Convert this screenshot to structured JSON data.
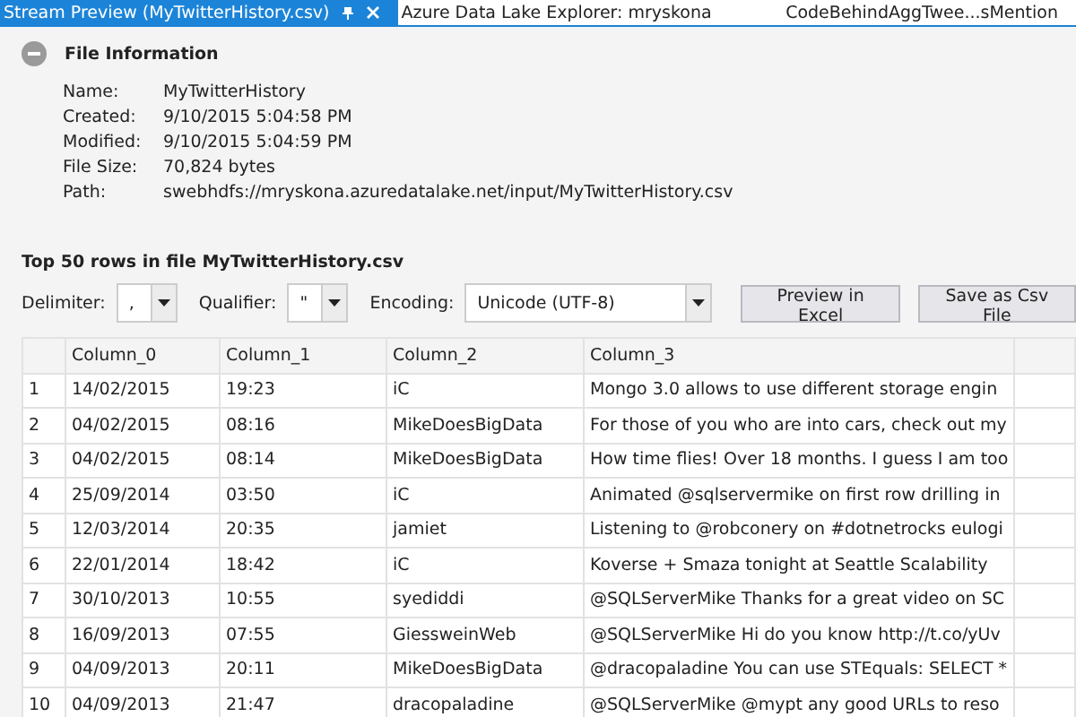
{
  "tabs": [
    {
      "label": "Stream Preview (MyTwitterHistory.csv)",
      "selected": true
    },
    {
      "label": "Azure Data Lake Explorer: mryskona",
      "selected": false
    },
    {
      "label": "CodeBehindAggTwee...sMention",
      "selected": false
    }
  ],
  "file_info": {
    "title": "File Information",
    "expanded": true,
    "fields": [
      {
        "label": "Name:",
        "value": "MyTwitterHistory"
      },
      {
        "label": "Created:",
        "value": "9/10/2015 5:04:58 PM"
      },
      {
        "label": "Modified:",
        "value": "9/10/2015 5:04:59 PM"
      },
      {
        "label": "File Size:",
        "value": "70,824 bytes"
      },
      {
        "label": "Path:",
        "value": "swebhdfs://mryskona.azuredatalake.net/input/MyTwitterHistory.csv"
      }
    ]
  },
  "preview": {
    "title": "Top 50 rows in file MyTwitterHistory.csv",
    "options": [
      {
        "label": "Delimiter:",
        "value": ",",
        "kind": "small"
      },
      {
        "label": "Qualifier:",
        "value": "\"",
        "kind": "small"
      },
      {
        "label": "Encoding:",
        "value": "Unicode (UTF-8)",
        "kind": "wide"
      }
    ],
    "buttons": [
      "Preview in Excel",
      "Save as Csv File"
    ]
  },
  "table": {
    "columns": [
      "Column_0",
      "Column_1",
      "Column_2",
      "Column_3"
    ],
    "rows": [
      {
        "n": "1",
        "cells": [
          "14/02/2015",
          "19:23",
          "iC",
          "Mongo 3.0 allows to use different storage engin"
        ]
      },
      {
        "n": "2",
        "cells": [
          "04/02/2015",
          "08:16",
          "MikeDoesBigData",
          "For those of you who are into cars, check out my"
        ]
      },
      {
        "n": "3",
        "cells": [
          "04/02/2015",
          "08:14",
          "MikeDoesBigData",
          "How time flies! Over 18 months. I guess I am too"
        ]
      },
      {
        "n": "4",
        "cells": [
          "25/09/2014",
          "03:50",
          "iC",
          "Animated @sqlservermike on first row drilling in"
        ]
      },
      {
        "n": "5",
        "cells": [
          "12/03/2014",
          "20:35",
          "jamiet",
          "Listening to @robconery on #dotnetrocks eulogi"
        ]
      },
      {
        "n": "6",
        "cells": [
          "22/01/2014",
          "18:42",
          "iC",
          "Koverse + Smaza tonight at Seattle Scalability"
        ]
      },
      {
        "n": "7",
        "cells": [
          "30/10/2013",
          "10:55",
          "syediddi",
          "@SQLServerMike Thanks for a great video on SC"
        ]
      },
      {
        "n": "8",
        "cells": [
          "16/09/2013",
          "07:55",
          "GiessweinWeb",
          "@SQLServerMike Hi do you know http://t.co/yUv"
        ]
      },
      {
        "n": "9",
        "cells": [
          "04/09/2013",
          "20:11",
          "MikeDoesBigData",
          "@dracopaladine You can use STEquals: SELECT *"
        ]
      },
      {
        "n": "10",
        "cells": [
          "04/09/2013",
          "21:47",
          "dracopaladine",
          "@SQLServerMike @mypt any good URLs to reso"
        ]
      }
    ]
  }
}
